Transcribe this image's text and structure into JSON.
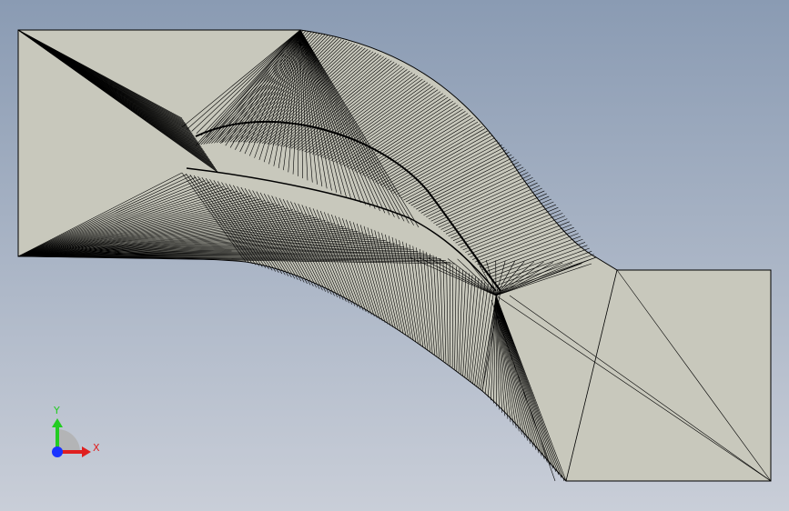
{
  "viewport": {
    "background_top": "#8a9bb3",
    "background_bottom": "#c9ced8",
    "mesh_fill": "#c8c8bc",
    "edge_color": "#000000"
  },
  "triad": {
    "y_label": "Y",
    "x_label": "X",
    "y_color": "#22cc22",
    "x_color": "#e02020",
    "z_color": "#1a33ff"
  }
}
